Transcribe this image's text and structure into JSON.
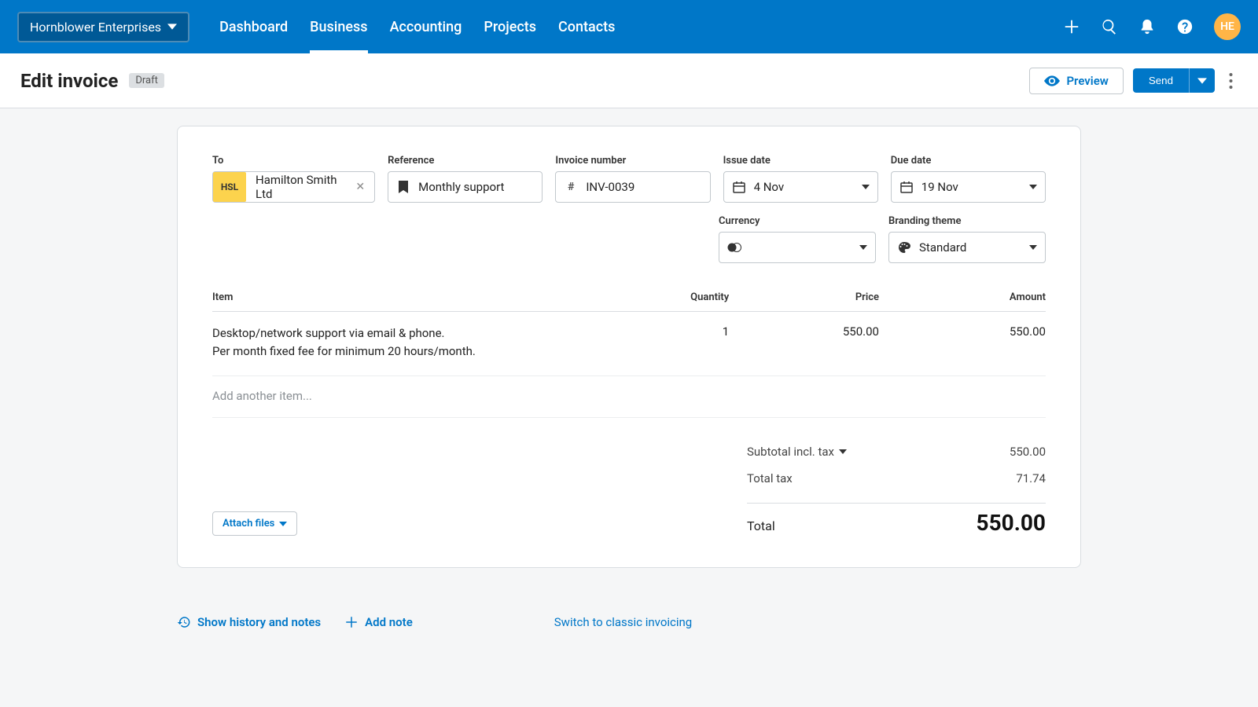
{
  "org": {
    "name": "Hornblower Enterprises",
    "avatar_initials": "HE"
  },
  "nav": {
    "tabs": [
      "Dashboard",
      "Business",
      "Accounting",
      "Projects",
      "Contacts"
    ],
    "active_index": 1
  },
  "page": {
    "title": "Edit invoice",
    "status_badge": "Draft",
    "preview_label": "Preview",
    "send_label": "Send"
  },
  "fields": {
    "to": {
      "label": "To",
      "chip_initials": "HSL",
      "value": "Hamilton Smith Ltd"
    },
    "reference": {
      "label": "Reference",
      "value": "Monthly support"
    },
    "invoice_number": {
      "label": "Invoice number",
      "value": "INV-0039"
    },
    "issue_date": {
      "label": "Issue date",
      "value": "4 Nov"
    },
    "due_date": {
      "label": "Due date",
      "value": "19 Nov"
    },
    "currency": {
      "label": "Currency",
      "value": ""
    },
    "branding_theme": {
      "label": "Branding theme",
      "value": "Standard"
    }
  },
  "columns": {
    "item": "Item",
    "qty": "Quantity",
    "price": "Price",
    "amount": "Amount"
  },
  "line_items": [
    {
      "desc": "Desktop/network support via email & phone.\nPer month fixed fee for minimum 20 hours/month.",
      "qty": "1",
      "price": "550.00",
      "amount": "550.00"
    }
  ],
  "add_item_placeholder": "Add another item...",
  "totals": {
    "subtotal_label": "Subtotal incl. tax",
    "subtotal_value": "550.00",
    "tax_label": "Total tax",
    "tax_value": "71.74",
    "total_label": "Total",
    "total_value": "550.00"
  },
  "attach_label": "Attach files",
  "footer": {
    "history_label": "Show history and notes",
    "add_note_label": "Add note",
    "switch_label": "Switch to classic invoicing"
  }
}
